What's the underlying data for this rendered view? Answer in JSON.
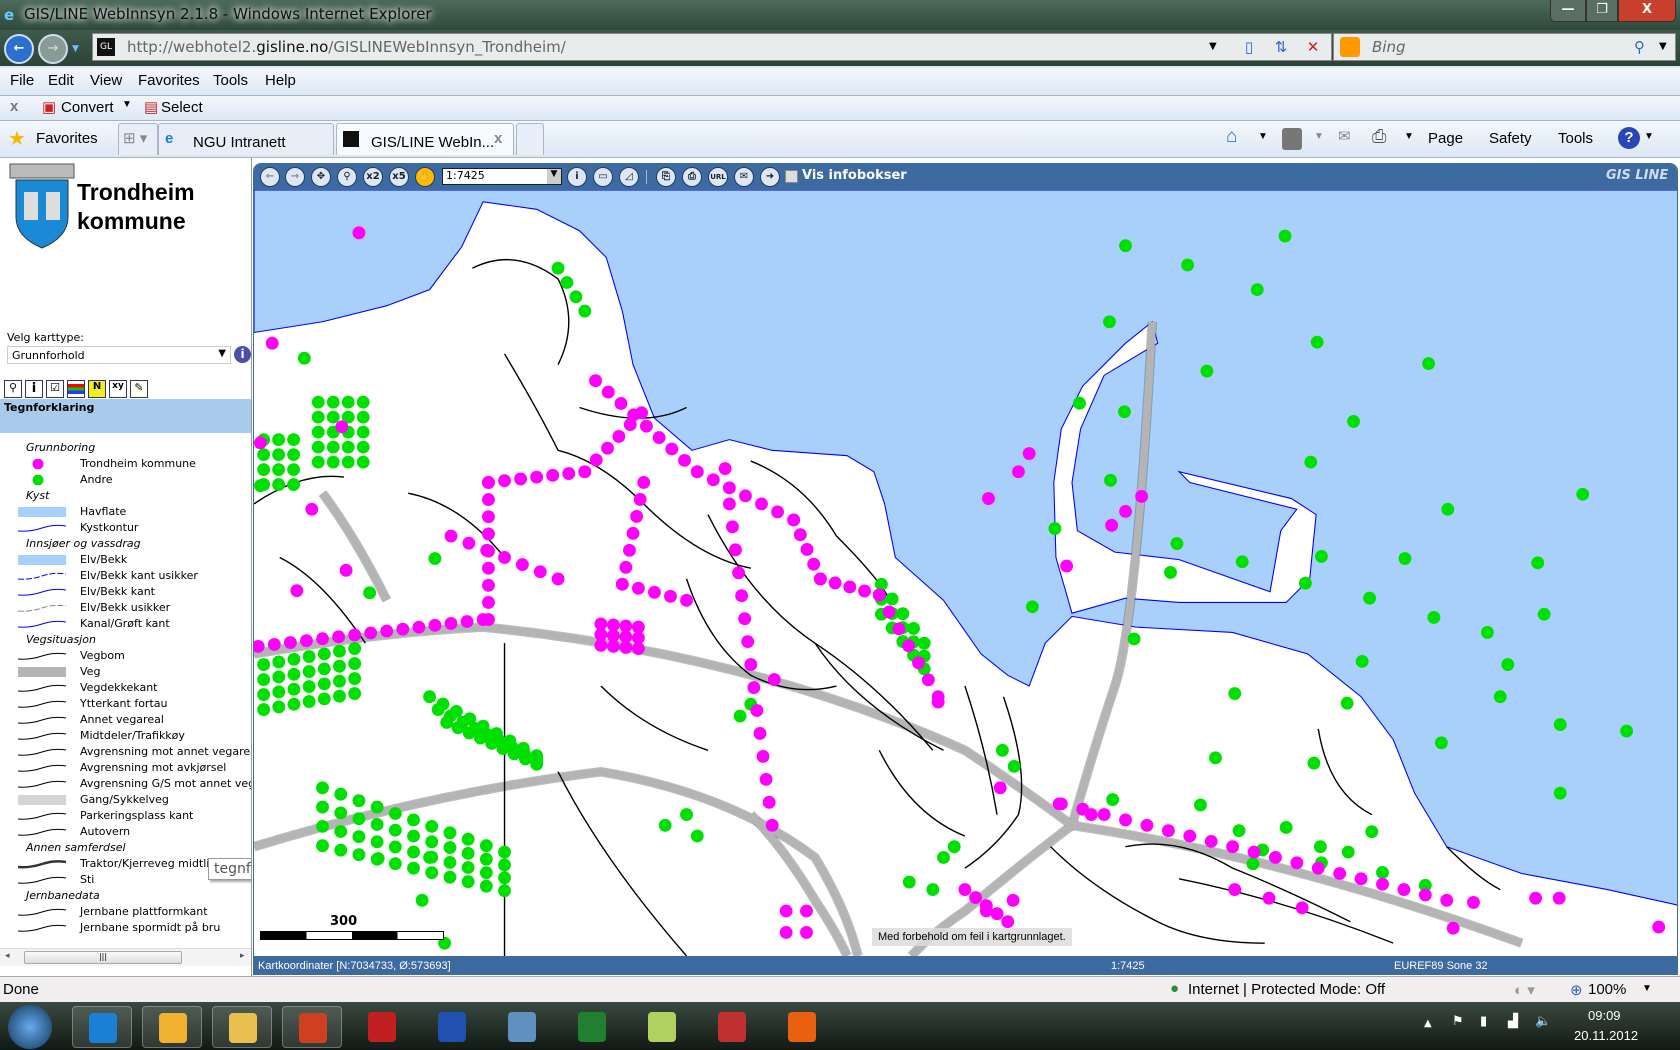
{
  "window": {
    "title": "GIS/LINE WebInnsyn 2.1.8 - Windows Internet Explorer",
    "min": "—",
    "max": "❐",
    "close": "X"
  },
  "address": {
    "url_prefix": "http://webhotel2.",
    "url_domain": "gisline.no",
    "url_path": "/GISLINEWebInnsyn_Trondheim/",
    "search_placeholder": "Bing"
  },
  "menu": [
    "File",
    "Edit",
    "View",
    "Favorites",
    "Tools",
    "Help"
  ],
  "commandbar": {
    "close": "x",
    "convert": "Convert",
    "select": "Select"
  },
  "favbar": {
    "favorites": "Favorites",
    "tabs": [
      {
        "label": "NGU Intranett"
      },
      {
        "label": "GIS/LINE WebIn...",
        "close": "x"
      }
    ],
    "tools": [
      "Page",
      "Safety",
      "Tools"
    ]
  },
  "sidebar": {
    "title_line1": "Trondheim",
    "title_line2": "kommune",
    "map_type_label": "Velg karttype:",
    "map_type_value": "Grunnforhold",
    "legend_header": "Tegnforklaring",
    "legend": [
      {
        "cat": "Grunnboring"
      },
      {
        "label": "Trondheim kommune",
        "sym": "dot",
        "color": "#ff00ff"
      },
      {
        "label": "Andre",
        "sym": "dot",
        "color": "#00e000"
      },
      {
        "cat": "Kyst"
      },
      {
        "label": "Havflate",
        "sym": "fill",
        "color": "#a8d0fb"
      },
      {
        "label": "Kystkontur",
        "sym": "line",
        "color": "#0000ff"
      },
      {
        "cat": "Innsjøer og vassdrag"
      },
      {
        "label": "Elv/Bekk",
        "sym": "fill",
        "color": "#a8d0fb"
      },
      {
        "label": "Elv/Bekk kant usikker",
        "sym": "dash",
        "color": "#0000ff"
      },
      {
        "label": "Elv/Bekk kant",
        "sym": "line",
        "color": "#0000ff"
      },
      {
        "label": "Elv/Bekk usikker",
        "sym": "dash",
        "color": "#888888"
      },
      {
        "label": "Kanal/Grøft kant",
        "sym": "line",
        "color": "#0000ff"
      },
      {
        "cat": "Vegsituasjon"
      },
      {
        "label": "Vegbom",
        "sym": "line",
        "color": "#000000"
      },
      {
        "label": "Veg",
        "sym": "fill",
        "color": "#b4b4b4"
      },
      {
        "label": "Vegdekkekant",
        "sym": "line",
        "color": "#000000"
      },
      {
        "label": "Ytterkant fortau",
        "sym": "line",
        "color": "#000000"
      },
      {
        "label": "Annet vegareal",
        "sym": "line",
        "color": "#000000"
      },
      {
        "label": "Midtdeler/Trafikkøy",
        "sym": "line",
        "color": "#000000"
      },
      {
        "label": "Avgrensning mot annet vegareal",
        "sym": "line",
        "color": "#000000"
      },
      {
        "label": "Avgrensning mot avkjørsel",
        "sym": "line",
        "color": "#000000"
      },
      {
        "label": "Avgrensning G/S mot annet vegareal",
        "sym": "line",
        "color": "#000000"
      },
      {
        "label": "Gang/Sykkelveg",
        "sym": "fill",
        "color": "#d4d4d4"
      },
      {
        "label": "Parkeringsplass kant",
        "sym": "line",
        "color": "#000000"
      },
      {
        "label": "Autovern",
        "sym": "line",
        "color": "#000000"
      },
      {
        "cat": "Annen samferdsel"
      },
      {
        "label": "Traktor/Kjerreveg midtlinje",
        "sym": "thick",
        "color": "#333333"
      },
      {
        "label": "Sti",
        "sym": "line",
        "color": "#000000"
      },
      {
        "cat": "Jernbanedata"
      },
      {
        "label": "Jernbane plattformkant",
        "sym": "line",
        "color": "#000000"
      },
      {
        "label": "Jernbane spormidt på bru",
        "sym": "line",
        "color": "#000000"
      }
    ],
    "tooltip": "tegnforklaring"
  },
  "map": {
    "scale_value": "1:7425",
    "infobox_label": "Vis infobokser",
    "brand": "GIS LINE",
    "scalebar_label": "300 m",
    "disclaimer": "Med forbehold om feil i kartgrunnlaget.",
    "coords": "Kartkoordinater [N:7034733, Ø:573693]",
    "status_scale": "1:7425",
    "projection": "EUREF89 Sone 32",
    "colors": {
      "sea": "#a8d0fb",
      "municipal_boring": "#ff00ff",
      "other_boring": "#00e000",
      "toolbar": "#3d6aa0"
    }
  },
  "statusbar": {
    "left": "Done",
    "zone": "Internet | Protected Mode: Off",
    "zoom": "100%"
  },
  "taskbar": {
    "time": "09:09",
    "date": "20.11.2012",
    "apps": [
      "internet-explorer",
      "outlook",
      "explorer",
      "powerpoint",
      "app-c",
      "word",
      "calculator",
      "excel",
      "sticky-notes",
      "snipping-tool",
      "firefox"
    ]
  }
}
